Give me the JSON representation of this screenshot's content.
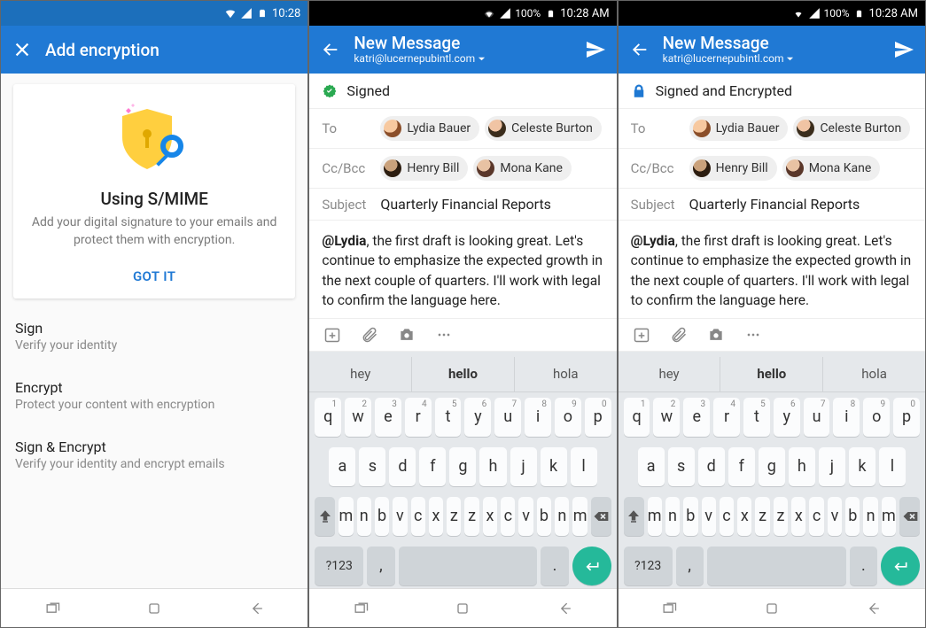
{
  "screen1": {
    "status": {
      "time": "10:28"
    },
    "appbar": {
      "title": "Add encryption"
    },
    "card": {
      "heading": "Using S/MIME",
      "desc": "Add your digital signature to your emails and protect them with encryption.",
      "cta": "GOT IT"
    },
    "options": [
      {
        "title": "Sign",
        "desc": "Verify your identity"
      },
      {
        "title": "Encrypt",
        "desc": "Protect your content with encryption"
      },
      {
        "title": "Sign & Encrypt",
        "desc": "Verify your identity and encrypt emails"
      }
    ]
  },
  "compose": {
    "status": {
      "battery_pct": "100%",
      "time": "10:28 AM"
    },
    "appbar": {
      "title": "New Message",
      "from": "katri@lucernepubintl.com"
    },
    "to_label": "To",
    "cc_label": "Cc/Bcc",
    "subject_label": "Subject",
    "to": [
      "Lydia Bauer",
      "Celeste Burton"
    ],
    "cc": [
      "Henry Bill",
      "Mona Kane"
    ],
    "subject": "Quarterly Financial Reports",
    "body_mention": "@Lydia",
    "body_rest": ", the first draft is looking great. Let's continue to emphasize the expected growth in the next couple of quarters. I'll work with legal to confirm the language here."
  },
  "screen2": {
    "security": {
      "text": "Signed",
      "icon": "verified-badge-icon",
      "color": "#2aa951"
    }
  },
  "screen3": {
    "security": {
      "text": "Signed and Encrypted",
      "icon": "lock-icon",
      "color": "#1e78d2"
    }
  },
  "keyboard": {
    "suggestions": [
      "hey",
      "hello",
      "hola"
    ],
    "row1": [
      {
        "k": "q",
        "n": "1"
      },
      {
        "k": "w",
        "n": "2"
      },
      {
        "k": "e",
        "n": "3"
      },
      {
        "k": "r",
        "n": "4"
      },
      {
        "k": "t",
        "n": "5"
      },
      {
        "k": "y",
        "n": "6"
      },
      {
        "k": "u",
        "n": "7"
      },
      {
        "k": "i",
        "n": "8"
      },
      {
        "k": "o",
        "n": "9"
      },
      {
        "k": "p",
        "n": "0"
      }
    ],
    "row2": [
      "a",
      "s",
      "d",
      "f",
      "g",
      "h",
      "j",
      "k",
      "l"
    ],
    "row3": [
      "z",
      "x",
      "c",
      "v",
      "b",
      "n",
      "m"
    ],
    "sym": "?123",
    "comma": ",",
    "period": "."
  }
}
